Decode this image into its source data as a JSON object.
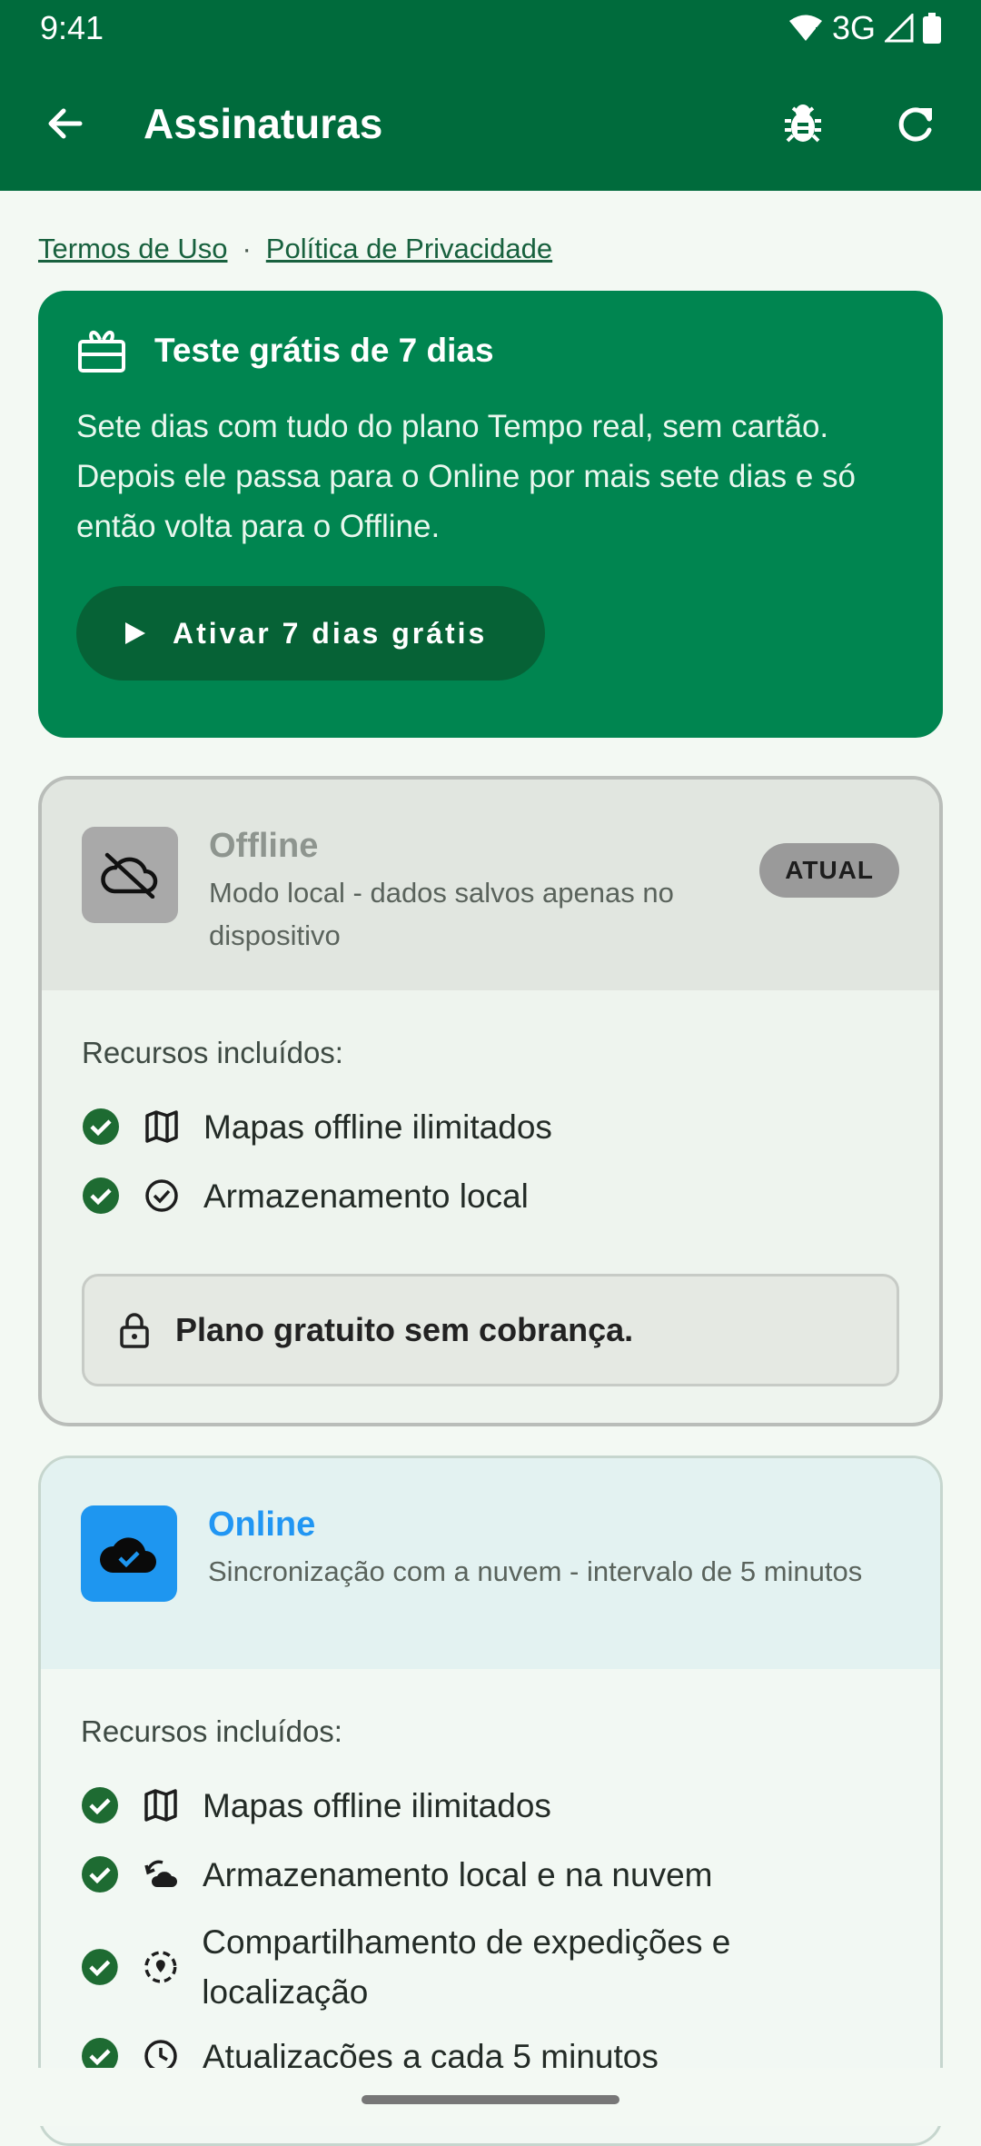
{
  "status": {
    "time": "9:41",
    "network": "3G"
  },
  "appbar": {
    "title": "Assinaturas"
  },
  "links": {
    "terms": "Termos de Uso",
    "separator": "·",
    "privacy": "Política de Privacidade"
  },
  "trial": {
    "title": "Teste grátis de 7 dias",
    "description": "Sete dias com tudo do plano Tempo real, sem cartão. Depois ele passa para o Online por mais sete dias e só então volta para o Offline.",
    "cta": "Ativar 7 dias grátis"
  },
  "plans": {
    "offline": {
      "name": "Offline",
      "subtitle": "Modo local - dados salvos apenas no dispositivo",
      "badge": "ATUAL",
      "features_title": "Recursos incluídos:",
      "features": [
        "Mapas offline ilimitados",
        "Armazenamento local"
      ],
      "note": "Plano gratuito sem cobrança."
    },
    "online": {
      "name": "Online",
      "subtitle": "Sincronização com a nuvem - intervalo de 5 minutos",
      "features_title": "Recursos incluídos:",
      "features": [
        "Mapas offline ilimitados",
        "Armazenamento local e na nuvem",
        "Compartilhamento de expedições e localização",
        "Atualizações a cada 5 minutos"
      ]
    }
  },
  "colors": {
    "primary": "#006b3c",
    "trial": "#008550",
    "online_accent": "#2196f3",
    "check": "#1e6b32"
  }
}
